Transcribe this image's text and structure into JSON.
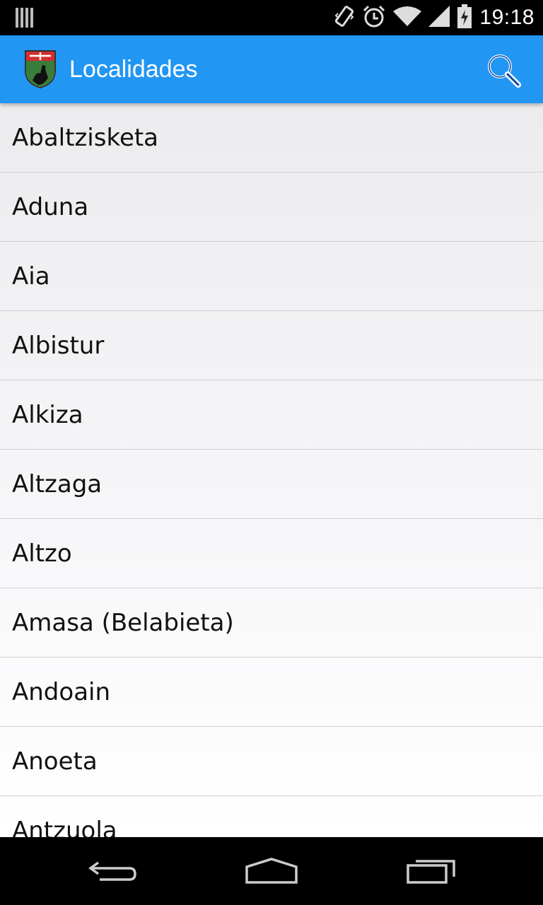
{
  "status_bar": {
    "time": "19:18",
    "icons": [
      "notification-bars-icon",
      "vibrate-icon",
      "alarm-icon",
      "wifi-icon",
      "signal-icon",
      "battery-icon"
    ]
  },
  "action_bar": {
    "title": "Localidades",
    "logo": "coat-of-arms-icon",
    "search_icon": "search-icon",
    "color": "#2196f3"
  },
  "list": {
    "items": [
      "Abaltzisketa",
      "Aduna",
      "Aia",
      "Albistur",
      "Alkiza",
      "Altzaga",
      "Altzo",
      "Amasa (Belabieta)",
      "Andoain",
      "Anoeta",
      "Antzuola"
    ]
  },
  "nav_bar": {
    "buttons": [
      "back-icon",
      "home-icon",
      "recent-apps-icon"
    ]
  }
}
